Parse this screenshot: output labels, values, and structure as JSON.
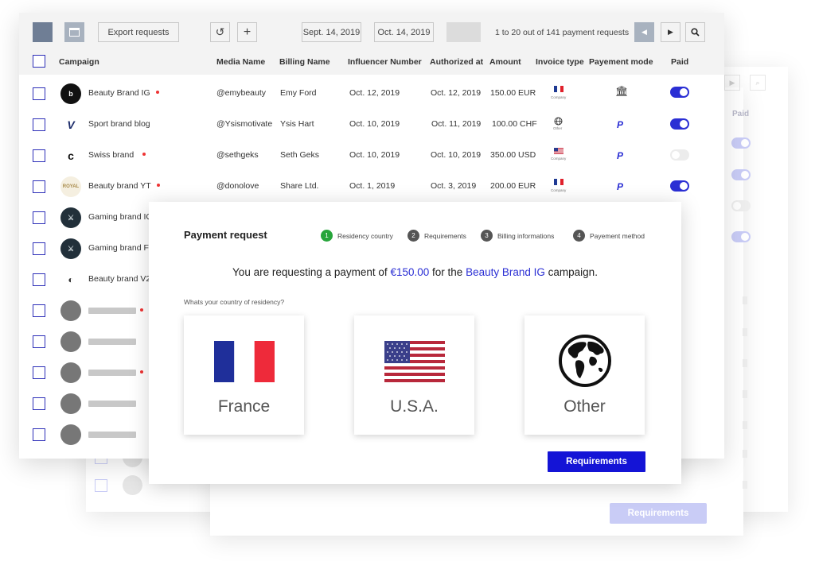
{
  "toolbar": {
    "export_label": "Export requests",
    "date_from": "Sept. 14, 2019",
    "date_to": "Oct. 14, 2019",
    "pagination": "1 to 20 out of 141 payment requests",
    "refresh_icon": "↺",
    "add_icon": "+",
    "prev_icon": "◀",
    "next_icon": "▶",
    "search_icon": "search-icon"
  },
  "columns": [
    "Campaign",
    "Media Name",
    "Billing Name",
    "Influencer Number",
    "Authorized at",
    "Amount",
    "Invoice type",
    "Payement mode",
    "Paid"
  ],
  "rows": [
    {
      "campaign": "Beauty Brand IG",
      "dot": true,
      "media": "@emybeauty",
      "billing": "Emy Ford",
      "influencer": "Oct. 12, 2019",
      "authorized": "Oct. 12, 2019",
      "amount": "150.00 EUR",
      "invoice": "Company",
      "invoice_flag": "fr",
      "mode": "bank",
      "paid": true
    },
    {
      "campaign": "Sport brand blog",
      "dot": false,
      "media": "@Ysismotivate",
      "billing": "Ysis Hart",
      "influencer": "Oct. 10, 2019",
      "authorized": "Oct. 11, 2019",
      "amount": "100.00 CHF",
      "invoice": "Other",
      "invoice_flag": "globe",
      "mode": "paypal",
      "paid": true
    },
    {
      "campaign": "Swiss brand",
      "dot": true,
      "media": "@sethgeks",
      "billing": "Seth Geks",
      "influencer": "Oct. 10, 2019",
      "authorized": "Oct. 10, 2019",
      "amount": "350.00 USD",
      "invoice": "Company",
      "invoice_flag": "us",
      "mode": "paypal",
      "paid": false
    },
    {
      "campaign": "Beauty brand YT",
      "dot": true,
      "media": "@donolove",
      "billing": "Share Ltd.",
      "influencer": "Oct. 1, 2019",
      "authorized": "Oct. 3, 2019",
      "amount": "200.00 EUR",
      "invoice": "Company",
      "invoice_flag": "fr",
      "mode": "paypal",
      "paid": true
    },
    {
      "campaign": "Gaming brand IG",
      "dot": false
    },
    {
      "campaign": "Gaming brand FB",
      "dot": false
    },
    {
      "campaign": "Beauty brand V2",
      "dot": false
    }
  ],
  "paypal_glyph": "P",
  "bank_glyph": "🏛",
  "modal": {
    "title": "Payment request",
    "steps": [
      {
        "num": "1",
        "label": "Residency country"
      },
      {
        "num": "2",
        "label": "Requirements"
      },
      {
        "num": "3",
        "label": "Billing informations"
      },
      {
        "num": "4",
        "label": "Payement method"
      }
    ],
    "request_prefix": "You are requesting a payment of",
    "request_amount": "€150.00",
    "request_middle": "for the",
    "request_campaign": "Beauty Brand IG",
    "request_suffix": "campaign.",
    "question": "Whats your country of residency?",
    "countries": [
      "France",
      "U.S.A.",
      "Other"
    ],
    "button": "Requirements"
  },
  "ghost": {
    "paid_header": "Paid",
    "button": "Requirements"
  },
  "colors": {
    "accent": "#1414d6",
    "step_active": "#27a53b",
    "notify_dot": "#e33333"
  }
}
